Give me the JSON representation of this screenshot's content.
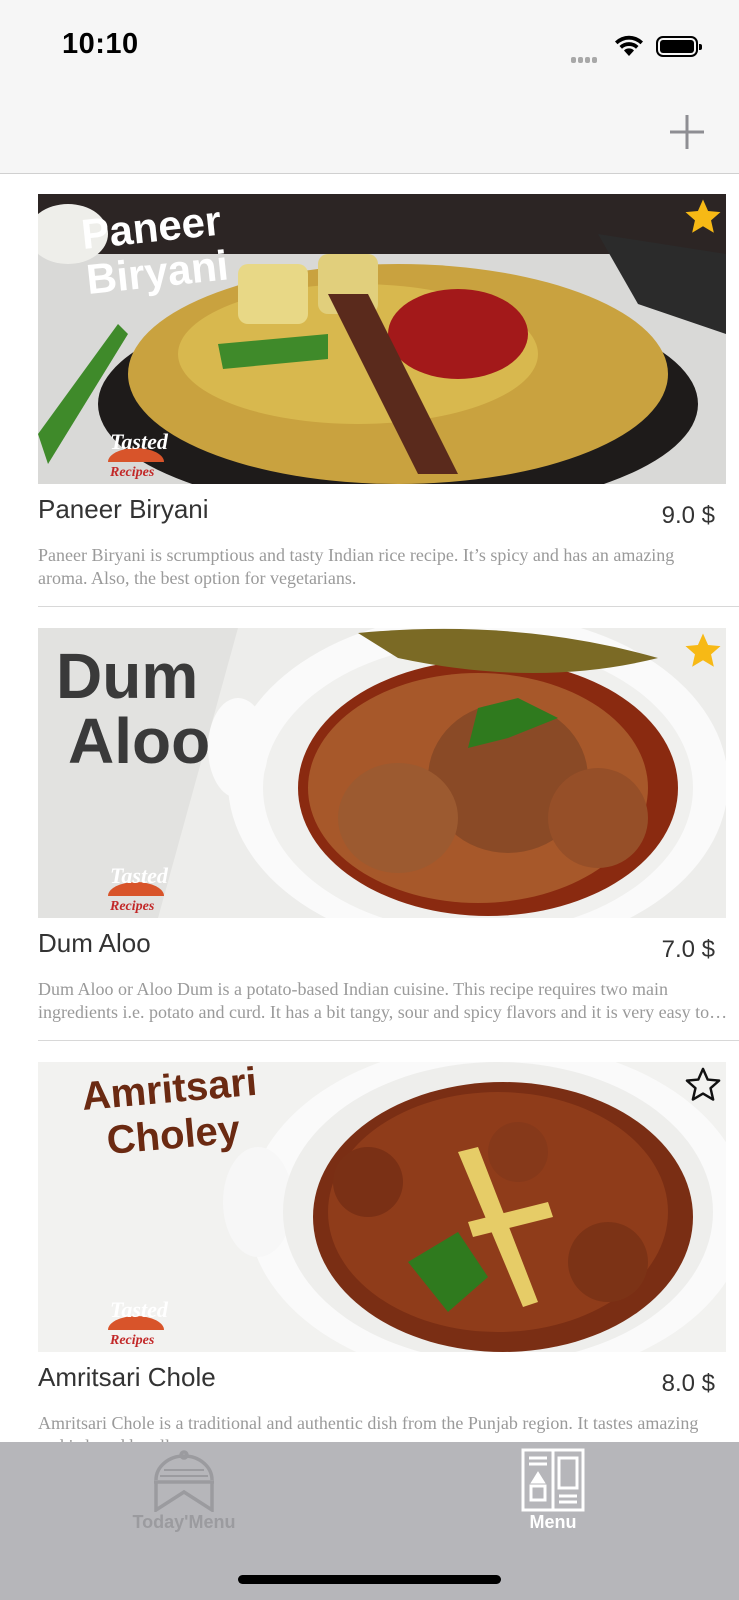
{
  "status_bar": {
    "time": "10:10"
  },
  "nav_bar": {
    "add_icon": "plus-icon"
  },
  "colors": {
    "star_active": "#f7b915",
    "tab_bar_bg": "#b6b6ba",
    "tab_active": "#ffffff",
    "tab_inactive": "#9b9b9f",
    "description": "#9a9a9a"
  },
  "recipes": [
    {
      "image_caption": [
        "Paneer",
        "Biryani"
      ],
      "watermark": [
        "Tasted",
        "Recipes"
      ],
      "title": "Paneer Biryani",
      "price": "9.0 $",
      "favorite": true,
      "description": "Paneer Biryani is scrumptious and tasty Indian rice recipe. It’s spicy and has an amazing aroma. Also, the best option for vegetarians."
    },
    {
      "image_caption": [
        "Dum",
        "Aloo"
      ],
      "watermark": [
        "Tasted",
        "Recipes"
      ],
      "title": "Dum Aloo",
      "price": "7.0 $",
      "favorite": true,
      "description": "Dum Aloo or Aloo Dum is a potato-based Indian cuisine. This recipe requires two main ingredients i.e. potato and curd. It has a bit tangy, sour and spicy flavors and it is very easy to make."
    },
    {
      "image_caption": [
        "Amritsari",
        "Choley"
      ],
      "watermark": [
        "Tasted",
        "Recipes"
      ],
      "title": "Amritsari Chole",
      "price": "8.0 $",
      "favorite": false,
      "description": "Amritsari Chole is a traditional and authentic dish from the Punjab region. It tastes amazing and is loved by all."
    }
  ],
  "tab_bar": {
    "tabs": [
      {
        "label": "Today'Menu",
        "icon": "cloche-icon",
        "selected": false
      },
      {
        "label": "Menu",
        "icon": "menu-book-icon",
        "selected": true
      }
    ]
  }
}
